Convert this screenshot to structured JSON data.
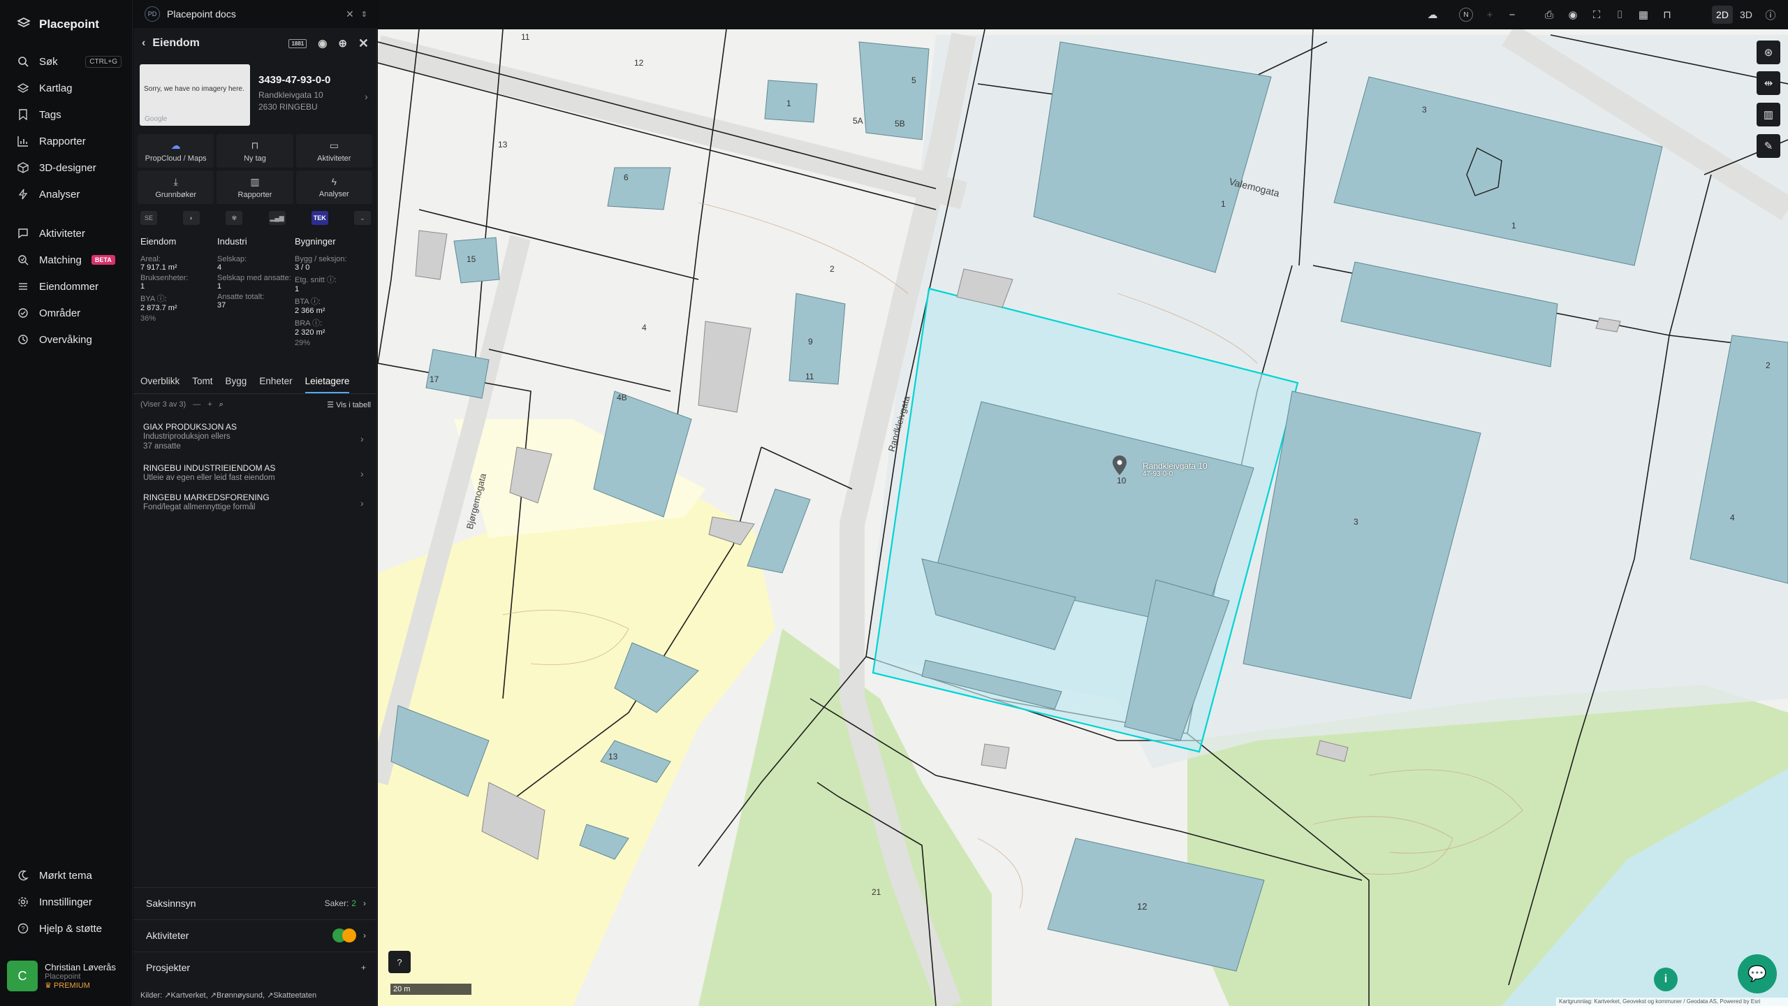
{
  "nav": {
    "brand": "Placepoint",
    "items": [
      {
        "label": "Søk",
        "shortcut": "CTRL+G"
      },
      {
        "label": "Kartlag"
      },
      {
        "label": "Tags"
      },
      {
        "label": "Rapporter"
      },
      {
        "label": "3D-designer"
      },
      {
        "label": "Analyser"
      },
      {
        "label": "Aktiviteter"
      },
      {
        "label": "Matching",
        "badge": "BETA"
      },
      {
        "label": "Eiendommer"
      },
      {
        "label": "Områder"
      },
      {
        "label": "Overvåking"
      }
    ],
    "bottom": [
      {
        "label": "Mørkt tema"
      },
      {
        "label": "Innstillinger"
      },
      {
        "label": "Hjelp & støtte"
      }
    ],
    "user": {
      "initial": "C",
      "name": "Christian Løverås",
      "org": "Placepoint",
      "plan": "PREMIUM"
    }
  },
  "docbar": {
    "badge": "PD",
    "title": "Placepoint docs"
  },
  "panel": {
    "title": "Eiendom",
    "head_badge": "1881",
    "thumb_text": "Sorry, we have no imagery here.",
    "thumb_credit": "Google",
    "property_id": "3439-47-93-0-0",
    "address_line1": "Randkleivgata 10",
    "address_line2": "2630 RINGEBU",
    "actions": [
      {
        "label": "PropCloud / Maps"
      },
      {
        "label": "Ny tag"
      },
      {
        "label": "Aktiviteter"
      },
      {
        "label": "Grunnbøker"
      },
      {
        "label": "Rapporter"
      },
      {
        "label": "Analyser"
      }
    ],
    "source_active": "TEK",
    "stats": {
      "eiendom": {
        "heading": "Eiendom",
        "areal_label": "Areal:",
        "areal_value": "7 917.1 m²",
        "bruksenheter_label": "Bruksenheter:",
        "bruksenheter_value": "1",
        "bya_label": "BYA ⓘ:",
        "bya_value": "2 873.7 m²",
        "bya_pct": "36%"
      },
      "industri": {
        "heading": "Industri",
        "selskap_label": "Selskap:",
        "selskap_value": "4",
        "ansatte_label": "Selskap med ansatte:",
        "ansatte_value": "1",
        "totalt_label": "Ansatte totalt:",
        "totalt_value": "37"
      },
      "bygninger": {
        "heading": "Bygninger",
        "seksjon_label": "Bygg / seksjon:",
        "seksjon_value": "3 / 0",
        "etg_label": "Etg. snitt ⓘ:",
        "etg_value": "1",
        "bta_label": "BTA ⓘ:",
        "bta_value": "2 366 m²",
        "bra_label": "BRA ⓘ:",
        "bra_value": "2 320 m²",
        "bra_pct": "29%"
      }
    },
    "tabs": [
      "Overblikk",
      "Tomt",
      "Bygg",
      "Enheter",
      "Leietagere"
    ],
    "active_tab": "Leietagere",
    "list_count": "(Viser 3 av 3)",
    "list_table": "Vis i tabell",
    "tenants": [
      {
        "name": "GIAX PRODUKSJON AS",
        "desc": "Industriproduksjon ellers",
        "extra": "37 ansatte"
      },
      {
        "name": "RINGEBU INDUSTRIEIENDOM AS",
        "desc": "Utleie av egen eller leid fast eiendom",
        "extra": ""
      },
      {
        "name": "RINGEBU MARKEDSFORENING",
        "desc": "Fond/legat allmennyttige formål",
        "extra": ""
      }
    ],
    "saksinnsyn": {
      "label": "Saksinnsyn",
      "count_label": "Saker:",
      "count": "2"
    },
    "aktiviteter": {
      "label": "Aktiviteter"
    },
    "prosjekter": {
      "label": "Prosjekter"
    },
    "sources": {
      "label": "Kilder:",
      "items": [
        "Kartverket",
        "Brønnøysund",
        "Skatteetaten"
      ]
    }
  },
  "topbar": {
    "north": "N",
    "view_2d": "2D",
    "view_3d": "3D",
    "active_view": "2D"
  },
  "map": {
    "scale_label": "20 m",
    "attribution": "Kartgrunnlag: Kartverket, Geovekst og kommuner / Geodata AS, Powered by Esri",
    "marker_label": "Randkleivgata 10",
    "marker_sub": "47-93-0-0",
    "street_labels": [
      "Valemogata",
      "Randkleivgata",
      "Bjørgemogata"
    ],
    "numbers": [
      "11",
      "12",
      "1",
      "5",
      "5A",
      "5B",
      "13",
      "6",
      "2",
      "9",
      "11",
      "15",
      "4",
      "4B",
      "17",
      "10",
      "3",
      "1",
      "1",
      "3",
      "2",
      "4",
      "12",
      "13",
      "21"
    ]
  },
  "colors": {
    "accent": "#4dabf7",
    "brand_green": "#159c76",
    "building": "#9fc3cc",
    "parcel": "#00d4d4"
  }
}
